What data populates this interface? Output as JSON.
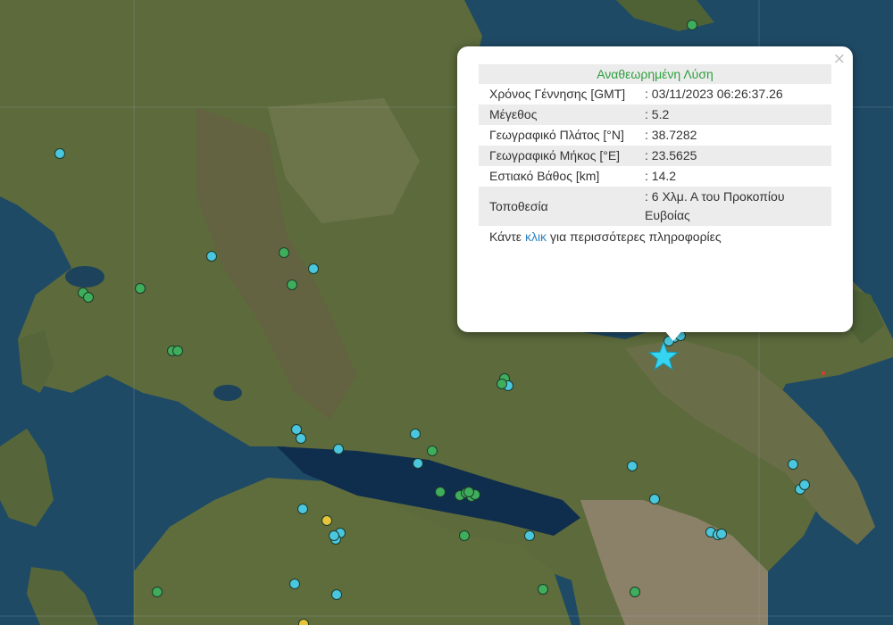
{
  "colors": {
    "land": "#5c6a3c",
    "water": "#1f4a66",
    "gulf": "#0f2d4d",
    "marker_green": "#3fae5c",
    "marker_cyan": "#4ac6df",
    "marker_yellow": "#e8c43a",
    "highlight_star": "#35d4f1",
    "title_green": "#2e9e3e",
    "link_blue": "#2a82c5"
  },
  "popup": {
    "close_label": "×",
    "title": "Αναθεωρημένη Λύση",
    "rows": [
      {
        "label": "Χρόνος Γέννησης [GMT]",
        "value": ": 03/11/2023 06:26:37.26"
      },
      {
        "label": "Μέγεθος",
        "value": ": 5.2"
      },
      {
        "label": "Γεωγραφικό Πλάτος [°N]",
        "value": ": 38.7282"
      },
      {
        "label": "Γεωγραφικό Μήκος [°E]",
        "value": ": 23.5625"
      },
      {
        "label": "Εστιακό Βάθος [km]",
        "value": ": 14.2"
      },
      {
        "label": "Τοποθεσία",
        "value": ": 6 Χλμ. Α του Προκοπίου Ευβοίας"
      }
    ],
    "more_prefix": "Κάντε",
    "more_link": "κλικ",
    "more_suffix": "για περισσότερες πληροφορίες"
  },
  "icons": {
    "close": "close-icon",
    "event": "star-icon"
  }
}
